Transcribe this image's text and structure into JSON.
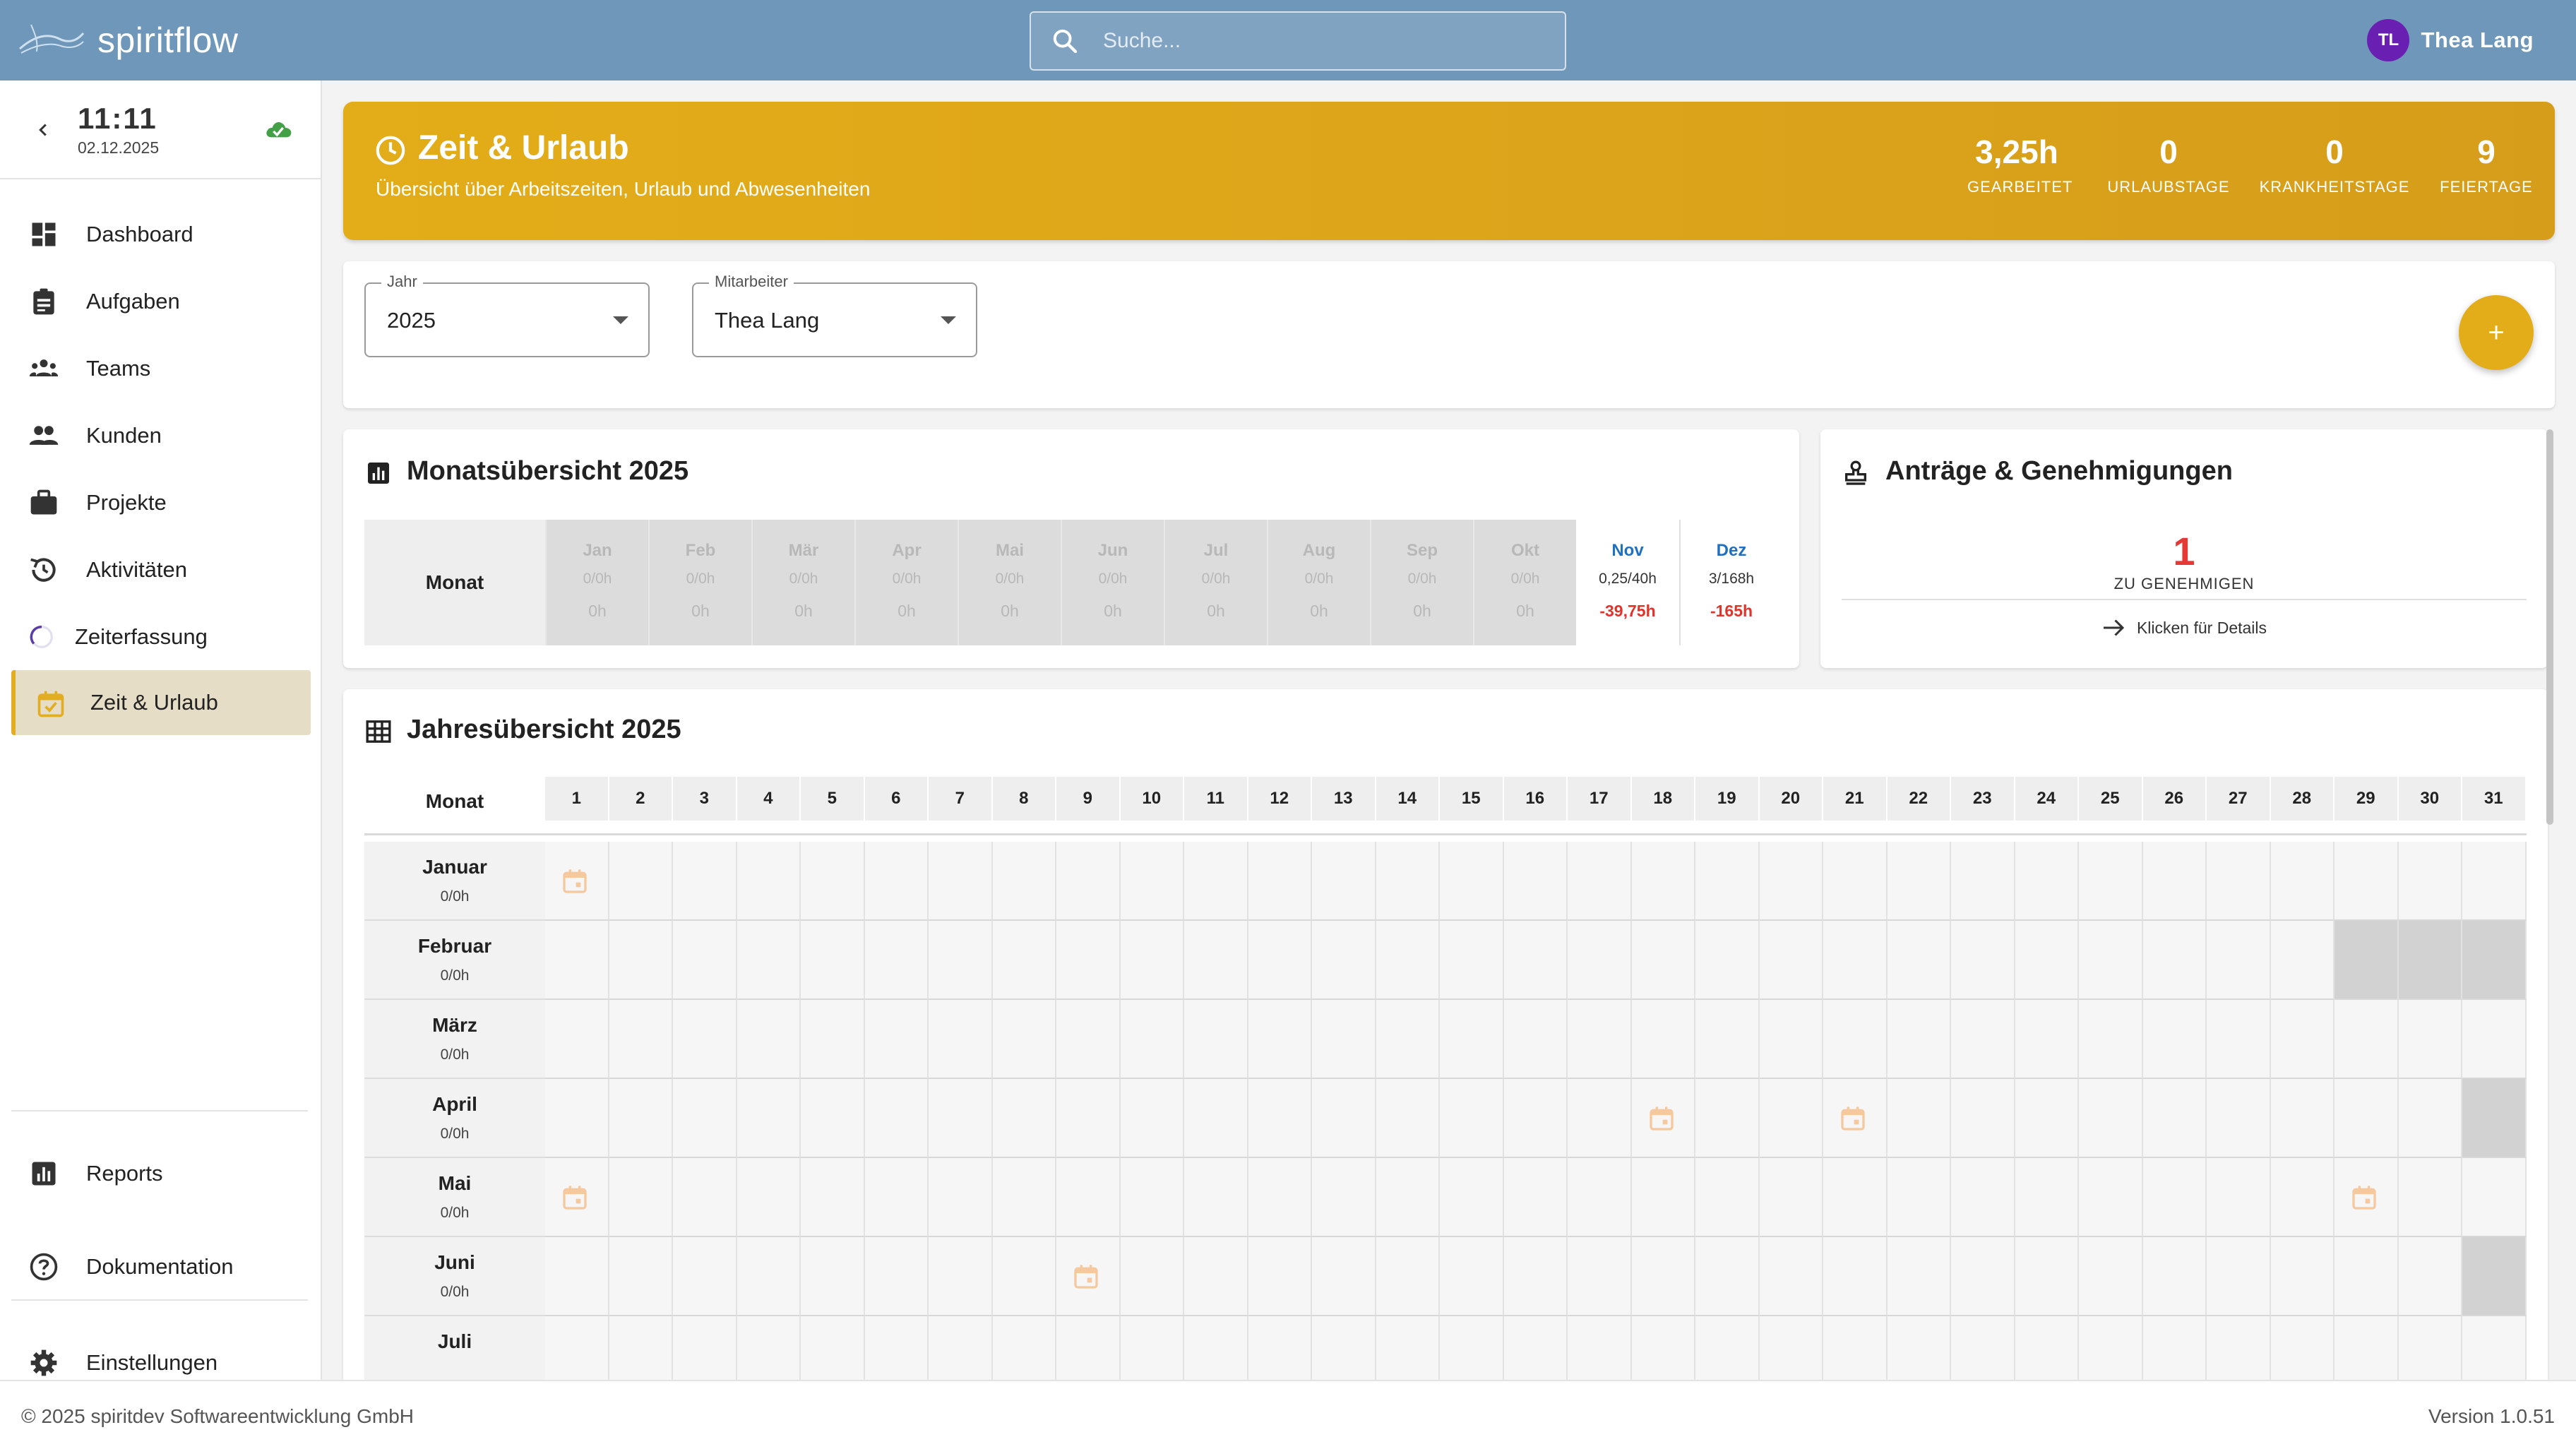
{
  "brand": {
    "name": "spiritflow"
  },
  "search": {
    "placeholder": "Suche..."
  },
  "user": {
    "initials": "TL",
    "name": "Thea Lang"
  },
  "clock": {
    "time": "11:11",
    "date": "02.12.2025"
  },
  "sidebar": {
    "items": [
      {
        "label": "Dashboard",
        "icon": "dashboard-icon"
      },
      {
        "label": "Aufgaben",
        "icon": "clipboard-icon"
      },
      {
        "label": "Teams",
        "icon": "teams-icon"
      },
      {
        "label": "Kunden",
        "icon": "people-icon"
      },
      {
        "label": "Projekte",
        "icon": "briefcase-icon"
      },
      {
        "label": "Aktivitäten",
        "icon": "history-icon"
      },
      {
        "label": "Zeiterfassung",
        "icon": "loading-circle-icon"
      },
      {
        "label": "Zeit & Urlaub",
        "icon": "calendar-check-icon",
        "active": true
      }
    ],
    "reports": "Reports",
    "docs": "Dokumentation",
    "settings": "Einstellungen"
  },
  "hero": {
    "title": "Zeit & Urlaub",
    "subtitle": "Übersicht über Arbeitszeiten, Urlaub und Abwesenheiten",
    "stats": [
      {
        "value": "3,25h",
        "label": "GEARBEITET"
      },
      {
        "value": "0",
        "label": "URLAUBSTAGE"
      },
      {
        "value": "0",
        "label": "KRANKHEITSTAGE"
      },
      {
        "value": "9",
        "label": "FEIERTAGE"
      }
    ]
  },
  "filters": {
    "year": {
      "label": "Jahr",
      "value": "2025"
    },
    "employee": {
      "label": "Mitarbeiter",
      "value": "Thea Lang"
    },
    "add_label": "+"
  },
  "monthly": {
    "title": "Monatsübersicht 2025",
    "row_label": "Monat",
    "months": [
      {
        "name": "Jan",
        "ratio": "0/0h",
        "saldo": "0h",
        "active": false
      },
      {
        "name": "Feb",
        "ratio": "0/0h",
        "saldo": "0h",
        "active": false
      },
      {
        "name": "Mär",
        "ratio": "0/0h",
        "saldo": "0h",
        "active": false
      },
      {
        "name": "Apr",
        "ratio": "0/0h",
        "saldo": "0h",
        "active": false
      },
      {
        "name": "Mai",
        "ratio": "0/0h",
        "saldo": "0h",
        "active": false
      },
      {
        "name": "Jun",
        "ratio": "0/0h",
        "saldo": "0h",
        "active": false
      },
      {
        "name": "Jul",
        "ratio": "0/0h",
        "saldo": "0h",
        "active": false
      },
      {
        "name": "Aug",
        "ratio": "0/0h",
        "saldo": "0h",
        "active": false
      },
      {
        "name": "Sep",
        "ratio": "0/0h",
        "saldo": "0h",
        "active": false
      },
      {
        "name": "Okt",
        "ratio": "0/0h",
        "saldo": "0h",
        "active": false
      },
      {
        "name": "Nov",
        "ratio": "0,25/40h",
        "saldo": "-39,75h",
        "active": true
      },
      {
        "name": "Dez",
        "ratio": "3/168h",
        "saldo": "-165h",
        "active": true
      }
    ]
  },
  "requests": {
    "title": "Anträge & Genehmigungen",
    "count": "1",
    "count_label": "ZU GENEHMIGEN",
    "link": "Klicken für Details"
  },
  "yearly": {
    "title": "Jahresübersicht 2025",
    "row_label": "Monat",
    "days": [
      "1",
      "2",
      "3",
      "4",
      "5",
      "6",
      "7",
      "8",
      "9",
      "10",
      "11",
      "12",
      "13",
      "14",
      "15",
      "16",
      "17",
      "18",
      "19",
      "20",
      "21",
      "22",
      "23",
      "24",
      "25",
      "26",
      "27",
      "28",
      "29",
      "30",
      "31"
    ],
    "rows": [
      {
        "month": "Januar",
        "hours": "0/0h",
        "holidays": [
          1
        ],
        "grey": []
      },
      {
        "month": "Februar",
        "hours": "0/0h",
        "holidays": [],
        "grey": [
          29,
          30,
          31
        ]
      },
      {
        "month": "März",
        "hours": "0/0h",
        "holidays": [],
        "grey": []
      },
      {
        "month": "April",
        "hours": "0/0h",
        "holidays": [
          18,
          21
        ],
        "grey": [
          31
        ]
      },
      {
        "month": "Mai",
        "hours": "0/0h",
        "holidays": [
          1,
          29
        ],
        "grey": []
      },
      {
        "month": "Juni",
        "hours": "0/0h",
        "holidays": [
          9
        ],
        "grey": [
          31
        ]
      },
      {
        "month": "Juli",
        "hours": "",
        "holidays": [],
        "grey": []
      }
    ]
  },
  "footer": {
    "copyright": "© 2025 spiritdev Softwareentwicklung GmbH",
    "version": "Version 1.0.51"
  },
  "colors": {
    "topbar": "#6f97b9",
    "accent": "#e3ad19",
    "negative": "#e0332a",
    "active_month": "#1f70c1"
  }
}
